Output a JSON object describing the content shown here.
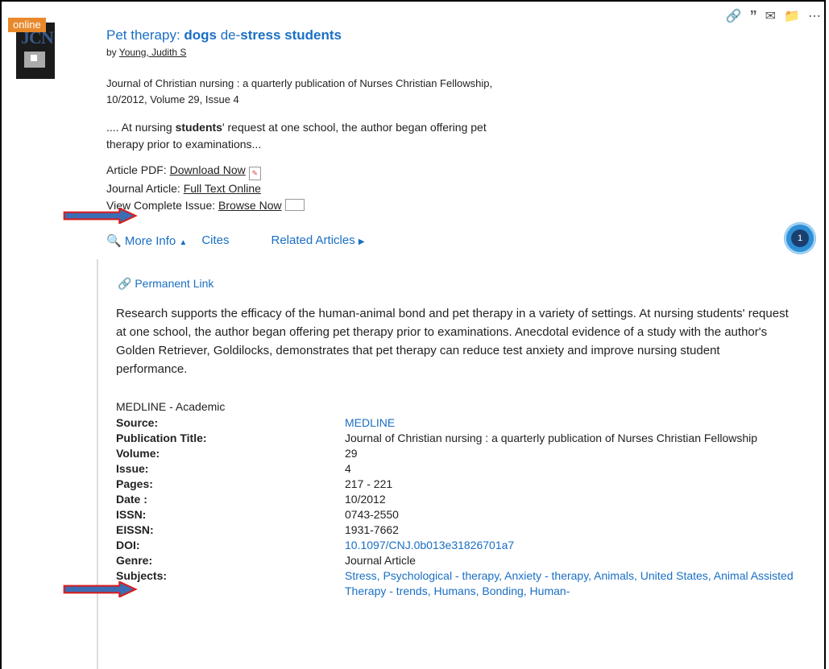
{
  "badge": "online",
  "cover_logo": "JCN",
  "actions": {
    "link_icon": "link-icon",
    "quote_icon": "quote-icon",
    "email_icon": "email-icon",
    "folder_icon": "folder-add-icon",
    "more_icon": "more-icon"
  },
  "title": {
    "part1": "Pet therapy: ",
    "part2": "dogs",
    "part3": " de-",
    "part4": "stress",
    "part5": " ",
    "part6": "students"
  },
  "byline": {
    "prefix": "by ",
    "author": "Young, Judith S"
  },
  "journal": {
    "line1": "Journal of Christian nursing : a quarterly publication of Nurses Christian Fellowship,",
    "line2": "10/2012, Volume 29, Issue 4"
  },
  "snippet": {
    "pre": ".... At nursing ",
    "bold": "students",
    "post": "' request at one school, the author began offering pet",
    "line2": "therapy prior to examinations..."
  },
  "links": [
    {
      "label": "Article PDF: ",
      "link": "Download Now"
    },
    {
      "label": "Journal Article: ",
      "link": "Full Text Online"
    },
    {
      "label": "View Complete Issue: ",
      "link": "Browse Now"
    }
  ],
  "tabs": {
    "more_info": "More Info",
    "cites": "Cites",
    "related": "Related Articles"
  },
  "circle_count": "1",
  "perm_link": "Permanent Link",
  "abstract": "Research supports the efficacy of the human-animal bond and pet therapy in a variety of settings. At nursing students' request at one school, the author began offering pet therapy prior to examinations. Anecdotal evidence of a study with the author's Golden Retriever, Goldilocks, demonstrates that pet therapy can reduce test anxiety and improve nursing student performance.",
  "database": "MEDLINE - Academic",
  "details": [
    {
      "k": "Source:",
      "v": "MEDLINE"
    },
    {
      "k": "Publication Title:",
      "v": "Journal of Christian nursing : a quarterly publication of Nurses Christian Fellowship"
    },
    {
      "k": "Volume:",
      "v": "29"
    },
    {
      "k": "Issue:",
      "v": "4"
    },
    {
      "k": "Pages:",
      "v": "217 - 221"
    },
    {
      "k": "Date :",
      "v": "10/2012"
    },
    {
      "k": "ISSN:",
      "v": "0743-2550"
    },
    {
      "k": "EISSN:",
      "v": "1931-7662"
    },
    {
      "k": "DOI:",
      "v": "10.1097/CNJ.0b013e31826701a7"
    },
    {
      "k": "Genre:",
      "v": "Journal Article"
    },
    {
      "k": "Subjects:",
      "v": "Stress, Psychological - therapy, Anxiety - therapy, Animals, United States, Animal Assisted Therapy - trends, Humans, Bonding, Human-"
    }
  ],
  "colors": {
    "link": "#1a6fc4",
    "badge": "#e8892b",
    "arrow_fill": "#3b6db5",
    "arrow_border": "#d62020"
  }
}
